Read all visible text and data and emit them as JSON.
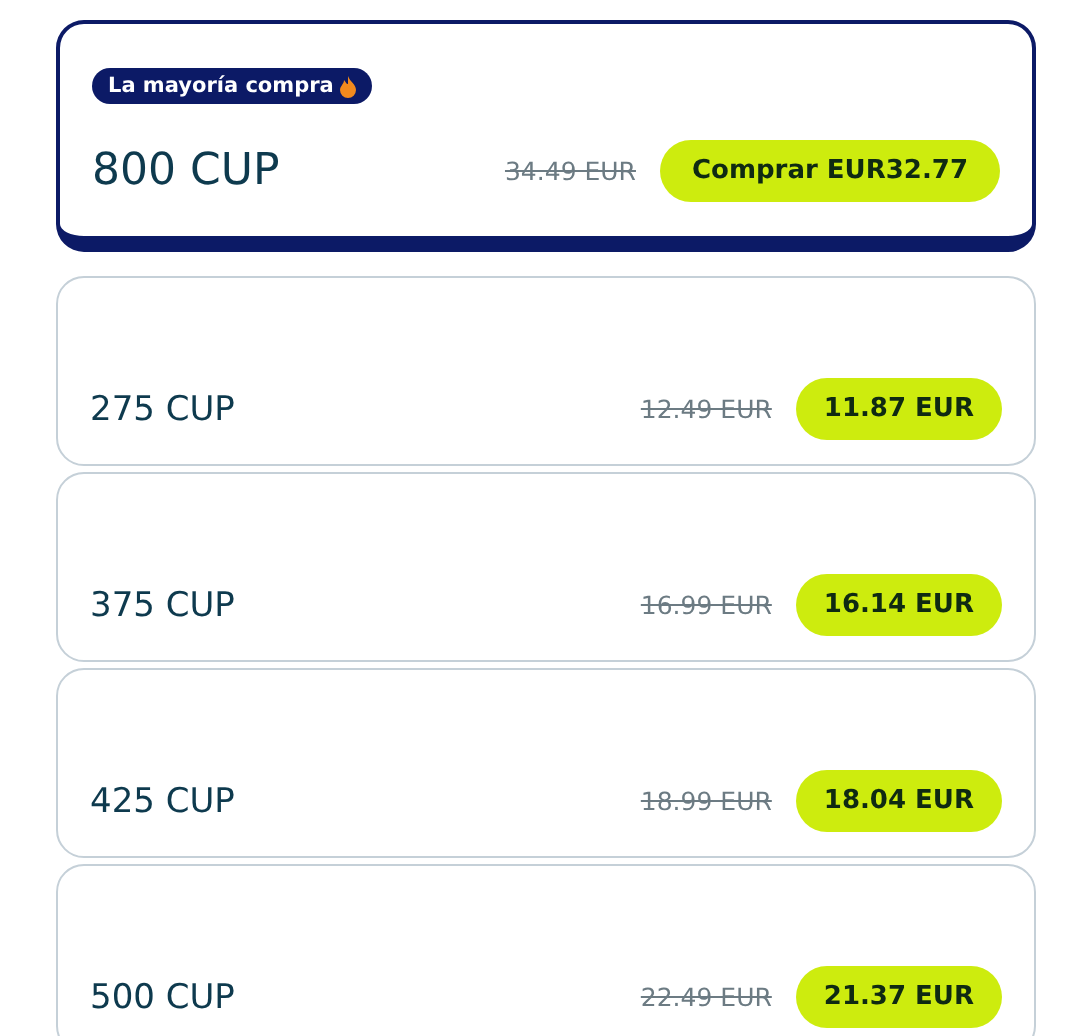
{
  "offers": [
    {
      "amount": "800 CUP",
      "old_price": "34.49 EUR",
      "button": "Comprar EUR32.77",
      "selected": true,
      "badge": "La mayoría compra"
    },
    {
      "amount": "275 CUP",
      "old_price": "12.49 EUR",
      "button": "11.87 EUR",
      "selected": false
    },
    {
      "amount": "375 CUP",
      "old_price": "16.99 EUR",
      "button": "16.14 EUR",
      "selected": false
    },
    {
      "amount": "425 CUP",
      "old_price": "18.99 EUR",
      "button": "18.04 EUR",
      "selected": false
    },
    {
      "amount": "500 CUP",
      "old_price": "22.49 EUR",
      "button": "21.37 EUR",
      "selected": false
    }
  ]
}
